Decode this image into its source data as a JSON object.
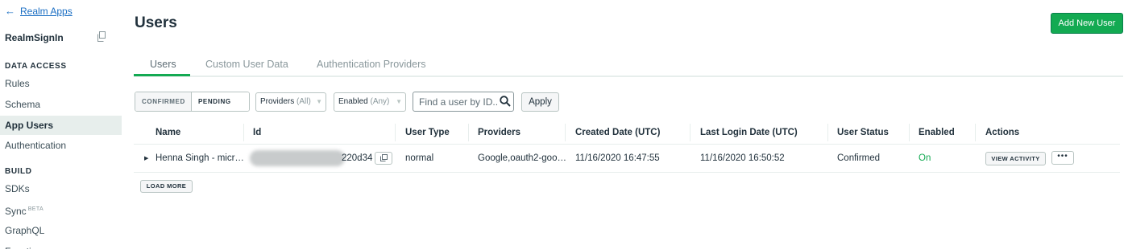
{
  "sidebar": {
    "back_label": "Realm Apps",
    "back_icon": "arrow-left-icon",
    "app_name": "RealmSignIn",
    "copy_icon": "copy-icon",
    "sections": [
      {
        "title": "DATA ACCESS",
        "items": [
          "Rules",
          "Schema",
          "App Users",
          "Authentication"
        ]
      },
      {
        "title": "BUILD",
        "items": [
          "SDKs",
          "Sync",
          "GraphQL",
          "Functions"
        ]
      }
    ],
    "active_item": "App Users",
    "sync_badge": "BETA"
  },
  "header": {
    "title": "Users",
    "add_button": "Add New User"
  },
  "tabs": [
    {
      "label": "Users",
      "active": true
    },
    {
      "label": "Custom User Data",
      "active": false
    },
    {
      "label": "Authentication Providers",
      "active": false
    }
  ],
  "toolbar": {
    "status_toggle": {
      "confirmed": "CONFIRMED",
      "pending": "PENDING",
      "selected": "PENDING"
    },
    "providers_filter": {
      "label": "Providers",
      "value": "(All)"
    },
    "enabled_filter": {
      "label": "Enabled",
      "value": "(Any)"
    },
    "search_placeholder": "Find a user by ID...",
    "apply_label": "Apply"
  },
  "table": {
    "columns": [
      "Name",
      "Id",
      "User Type",
      "Providers",
      "Created Date (UTC)",
      "Last Login Date (UTC)",
      "User Status",
      "Enabled",
      "Actions"
    ],
    "rows": [
      {
        "name": "Henna Singh - micr…",
        "id_suffix": "220d34",
        "user_type": "normal",
        "providers": "Google,oauth2-goo…",
        "created": "11/16/2020 16:47:55",
        "last_login": "11/16/2020 16:50:52",
        "status": "Confirmed",
        "enabled": "On",
        "view_activity": "VIEW ACTIVITY",
        "more": "•••"
      }
    ],
    "load_more": "LOAD MORE"
  },
  "colors": {
    "accent_green": "#13aa52",
    "link_blue": "#1a6ec3",
    "active_nav_bg": "#e7eeec"
  }
}
